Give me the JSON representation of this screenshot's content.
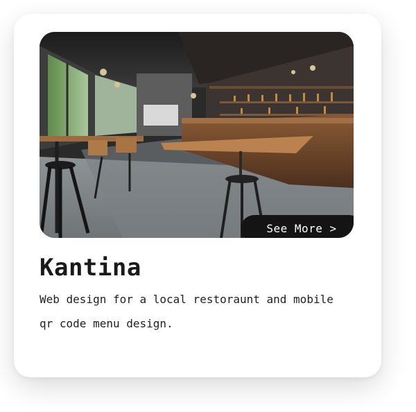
{
  "card": {
    "image_alt": "Restaurant interior with bar and stools",
    "cta_label": "See More >",
    "title": "Kantina",
    "description": "Web design for a local restoraunt and mobile qr code menu design."
  },
  "colors": {
    "card_background": "#ffffff",
    "button_background": "#141414",
    "button_text": "#ffffff",
    "title_text": "#1a1a1a"
  }
}
